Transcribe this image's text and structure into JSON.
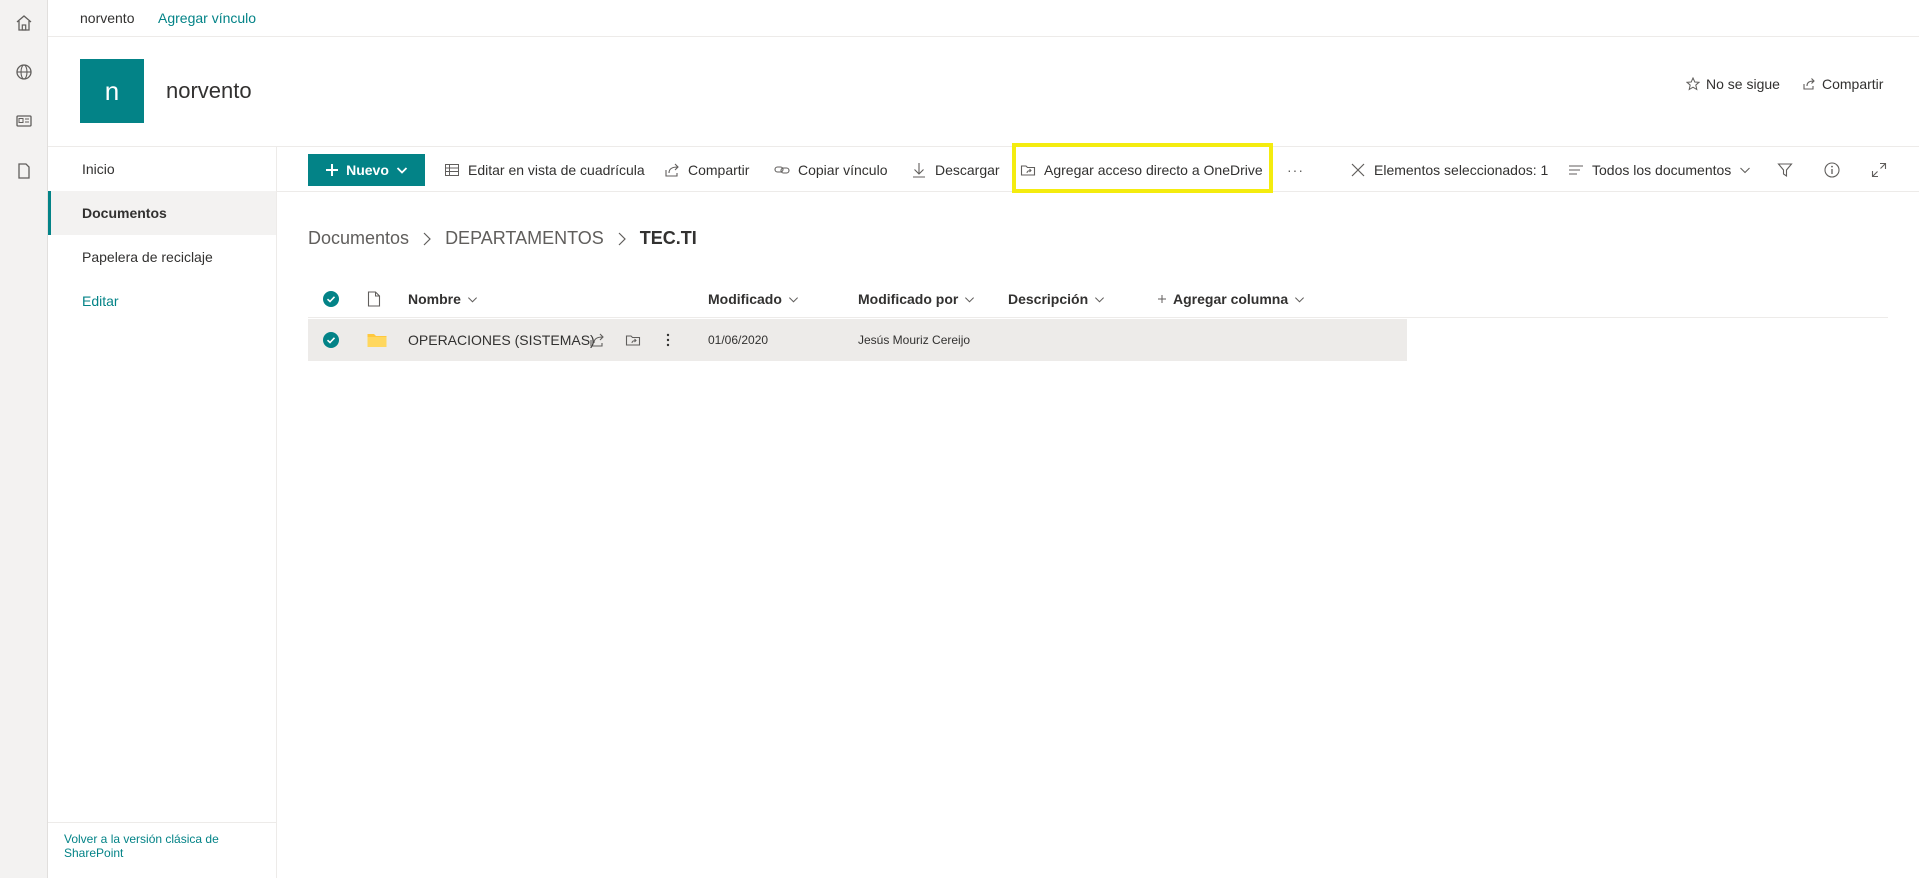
{
  "topbar": {
    "site_link": "norvento",
    "add_link": "Agregar vínculo"
  },
  "site": {
    "logo_letter": "n",
    "title": "norvento",
    "follow": "No se sigue",
    "share": "Compartir"
  },
  "nav": {
    "items": [
      {
        "label": "Inicio"
      },
      {
        "label": "Documentos"
      },
      {
        "label": "Papelera de reciclaje"
      },
      {
        "label": "Editar"
      }
    ],
    "classic_link": "Volver a la versión clásica de SharePoint"
  },
  "commands": {
    "new": "Nuevo",
    "grid_edit": "Editar en vista de cuadrícula",
    "share": "Compartir",
    "copy_link": "Copiar vínculo",
    "download": "Descargar",
    "add_shortcut": "Agregar acceso directo a OneDrive",
    "more": "···",
    "selected": "Elementos seleccionados: 1",
    "view": "Todos los documentos"
  },
  "breadcrumb": {
    "items": [
      "Documentos",
      "DEPARTAMENTOS"
    ],
    "current": "TEC.TI"
  },
  "columns": {
    "name": "Nombre",
    "modified": "Modificado",
    "modified_by": "Modificado por",
    "description": "Descripción",
    "add_column": "Agregar columna"
  },
  "rows": [
    {
      "name": "OPERACIONES (SISTEMAS)",
      "modified": "01/06/2020",
      "modified_by": "Jesús Mouriz Cereijo",
      "description": ""
    }
  ],
  "colors": {
    "accent": "#038387",
    "highlight": "#f4ec0f",
    "folder": "#ffc83d",
    "selected_row": "#edebe9"
  }
}
